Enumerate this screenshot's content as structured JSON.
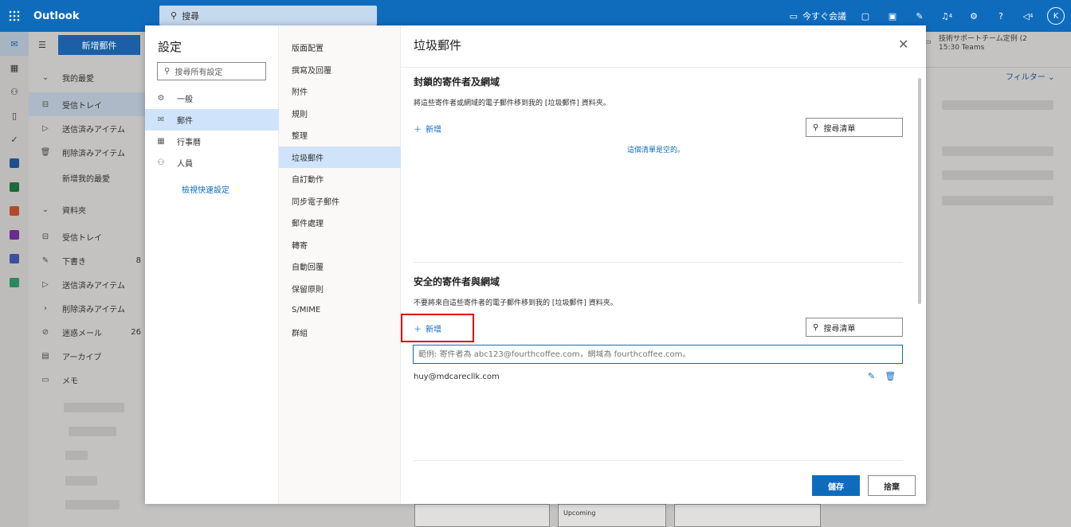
{
  "topbar": {
    "app_name": "Outlook",
    "search_placeholder": "搜尋",
    "meet_now": "今すぐ会議",
    "notif_badge_1": "4",
    "notif_badge_2": "4",
    "avatar_initial": "K"
  },
  "folders": {
    "new_mail": "新增郵件",
    "favorites": "我的最愛",
    "items": [
      {
        "label": "受信トレイ",
        "count": ""
      },
      {
        "label": "送信済みアイテム",
        "count": ""
      },
      {
        "label": "削除済みアイテム",
        "count": ""
      },
      {
        "label": "新增我的最愛",
        "count": ""
      },
      {
        "label": "資料夾",
        "count": ""
      },
      {
        "label": "受信トレイ",
        "count": ""
      },
      {
        "label": "下書き",
        "count": "8"
      },
      {
        "label": "送信済みアイテム",
        "count": ""
      },
      {
        "label": "削除済みアイテム",
        "count": ""
      },
      {
        "label": "迷惑メール",
        "count": "26"
      },
      {
        "label": "アーカイブ",
        "count": ""
      },
      {
        "label": "メモ",
        "count": ""
      }
    ]
  },
  "right_pane": {
    "event_title": "技術サポートチーム定例 (2",
    "event_time": "15:30 Teams",
    "filter": "フィルター"
  },
  "settings": {
    "title": "設定",
    "search_placeholder": "搜尋所有設定",
    "categories": [
      {
        "label": "一般",
        "icon": "gear-icon"
      },
      {
        "label": "郵件",
        "icon": "mail-icon"
      },
      {
        "label": "行事曆",
        "icon": "calendar-icon"
      },
      {
        "label": "人員",
        "icon": "people-icon"
      }
    ],
    "quick_settings": "檢視快速設定",
    "mail_sections": [
      "版面配置",
      "撰寫及回覆",
      "附件",
      "規則",
      "整理",
      "垃圾郵件",
      "自訂動作",
      "同步電子郵件",
      "郵件處理",
      "轉寄",
      "自動回覆",
      "保留原則",
      "S/MIME",
      "群組"
    ]
  },
  "junk": {
    "title": "垃圾郵件",
    "blocked": {
      "heading": "封鎖的寄件者及網域",
      "description": "將這些寄件者或網域的電子郵件移到我的 [垃圾郵件] 資料夾。",
      "add": "新增",
      "search": "搜尋清單",
      "empty": "這個清單是空的。"
    },
    "safe": {
      "heading": "安全的寄件者與網域",
      "description": "不要將來自這些寄件者的電子郵件移到我的 [垃圾郵件] 資料夾。",
      "add": "新增",
      "search": "搜尋清單",
      "input_placeholder": "範例: 寄件者為 abc123@fourthcoffee.com，網域為 fourthcoffee.com。",
      "entries": [
        "huy@mdcarecllk.com"
      ]
    },
    "save": "儲存",
    "discard": "捨棄"
  },
  "bottom": {
    "upcoming": "Upcoming"
  },
  "colors": {
    "brand": "#0f6cbd",
    "highlight": "#e00000"
  }
}
